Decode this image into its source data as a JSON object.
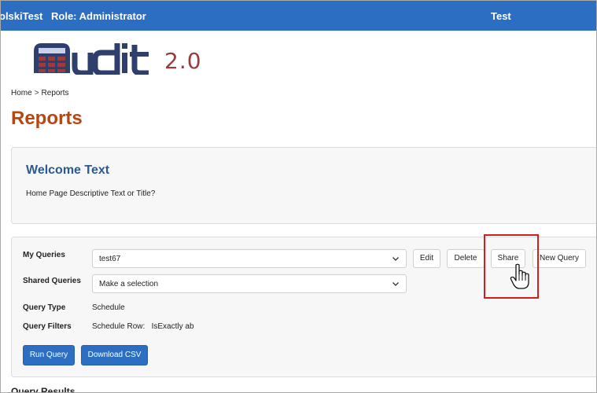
{
  "topbar": {
    "user": "olskiTest",
    "role": "Role: Administrator",
    "right_label": "Test"
  },
  "logo": {
    "text": "udit2.0"
  },
  "breadcrumb": {
    "home": "Home",
    "separator": ">",
    "current": "Reports"
  },
  "page": {
    "title": "Reports"
  },
  "welcome": {
    "title": "Welcome Text",
    "description": "Home Page Descriptive Text or Title?"
  },
  "queries": {
    "my_queries_label": "My Queries",
    "my_queries_value": "test67",
    "shared_queries_label": "Shared Queries",
    "shared_queries_value": "Make a selection",
    "query_type_label": "Query Type",
    "query_type_value": "Schedule",
    "query_filters_label": "Query Filters",
    "query_filters_value": "Schedule Row:   IsExactly ab",
    "buttons": {
      "edit": "Edit",
      "delete": "Delete",
      "share": "Share",
      "new_query": "New Query",
      "run_query": "Run Query",
      "download_csv": "Download CSV"
    }
  },
  "results": {
    "heading": "Query Results"
  },
  "colors": {
    "topbar": "#2c6fc2",
    "title_orange": "#b8470f",
    "heading_blue": "#2b5a93",
    "highlight_red": "#d41e1e",
    "logo_navy": "#2e3f6e",
    "logo_red": "#9b3b3b"
  }
}
